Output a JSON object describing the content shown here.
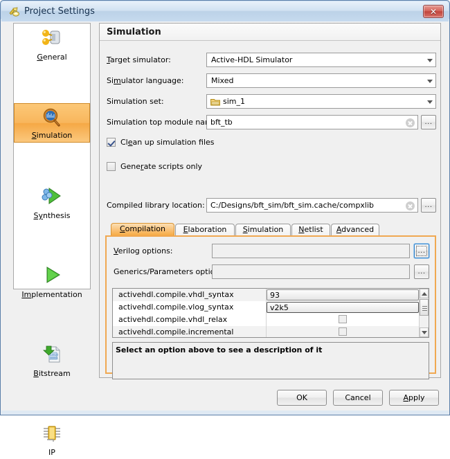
{
  "window": {
    "title": "Project Settings",
    "app_icon": "vivado-icon",
    "close_label": "✕"
  },
  "sidebar": {
    "items": [
      {
        "label": "General",
        "label_pre": "G",
        "label_post": "eneral",
        "icon": "general-icon",
        "selected": false
      },
      {
        "label": "Simulation",
        "label_pre": "S",
        "label_post": "imulation",
        "icon": "simulation-icon",
        "selected": true
      },
      {
        "label": "Synthesis",
        "label_pre": "Sy",
        "label_post": "nthesis",
        "icon": "synthesis-icon",
        "selected": false
      },
      {
        "label": "Implementation",
        "label_pre": "Im",
        "label_post": "plementation",
        "icon": "implementation-icon",
        "selected": false
      },
      {
        "label": "Bitstream",
        "label_pre": "B",
        "label_post": "itstream",
        "icon": "bitstream-icon",
        "selected": false
      },
      {
        "label": "IP",
        "label_pre": "",
        "label_post": "IP",
        "icon": "ip-icon",
        "selected": false
      }
    ]
  },
  "panel": {
    "title": "Simulation",
    "fields": {
      "target_simulator": {
        "label_pre": "T",
        "label_post": "arget simulator:",
        "value": "Active-HDL Simulator"
      },
      "simulator_language": {
        "label_pre": "Si",
        "label_mid": "m",
        "label_post": "ulator language:",
        "value": "Mixed"
      },
      "simulation_set": {
        "label": "Simulation set:",
        "value": "sim_1",
        "icon": "folder-icon"
      },
      "top_module": {
        "label": "Simulation top module name:",
        "value": "bft_tb",
        "clear_icon": "clear-icon",
        "browse_label": "..."
      },
      "compiled_library": {
        "label": "Compiled library location:",
        "value": "C:/Designs/bft_sim/bft_sim.cache/compxlib",
        "clear_icon": "clear-icon",
        "browse_label": "..."
      }
    },
    "checkboxes": [
      {
        "label_pre": "Cl",
        "label_mid": "e",
        "label_post": "an up simulation files",
        "checked": true
      },
      {
        "label_pre": "Gene",
        "label_mid": "r",
        "label_post": "ate scripts only",
        "checked": false
      }
    ]
  },
  "tabs": [
    {
      "label": "Compilation",
      "accel_pre": "C",
      "accel_post": "ompilation",
      "active": true
    },
    {
      "label": "Elaboration",
      "accel_pre": "E",
      "accel_post": "laboration",
      "active": false
    },
    {
      "label": "Simulation",
      "accel_pre": "S",
      "accel_post": "imulation",
      "active": false
    },
    {
      "label": "Netlist",
      "accel_pre": "N",
      "accel_post": "etlist",
      "active": false
    },
    {
      "label": "Advanced",
      "accel_pre": "A",
      "accel_post": "dvanced",
      "active": false
    }
  ],
  "tab_content": {
    "verilog_options": {
      "label_pre": "V",
      "label_post": "erilog options:",
      "value": "",
      "browse_label": "...",
      "browse_focused": true
    },
    "generics_options": {
      "label": "Generics/Parameters options:",
      "value": "",
      "browse_label": "...",
      "browse_focused": false
    },
    "properties": [
      {
        "name": "activehdl.compile.vhdl_syntax",
        "type": "text",
        "value": "93",
        "selected": false
      },
      {
        "name": "activehdl.compile.vlog_syntax",
        "type": "text",
        "value": "v2k5",
        "selected": true
      },
      {
        "name": "activehdl.compile.vhdl_relax",
        "type": "checkbox",
        "value": "",
        "checked": false
      },
      {
        "name": "activehdl.compile.incremental",
        "type": "checkbox",
        "value": "",
        "checked": false
      }
    ],
    "description": "Select an option above to see a description of it",
    "scrollbar": {
      "up_icon": "scroll-up-icon",
      "down_icon": "scroll-down-icon"
    }
  },
  "footer": {
    "ok": "OK",
    "cancel": "Cancel",
    "apply_pre": "A",
    "apply_post": "pply"
  },
  "colors": {
    "accent_orange": "#f0a851",
    "selection_orange": "#f8b65c",
    "title_blue": "#bcd2e8",
    "close_red": "#c0453c"
  }
}
